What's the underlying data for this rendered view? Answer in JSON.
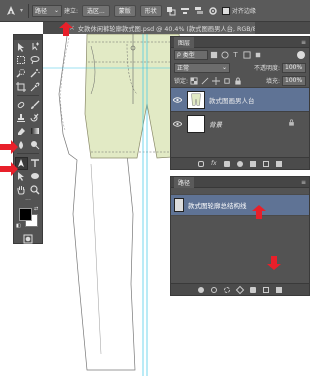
{
  "options_bar": {
    "tool_icon": "pen-icon",
    "mode_value": "路径",
    "make_label": "建立:",
    "selection_button": "选区...",
    "mask_button": "蒙版",
    "shape_button": "形状",
    "align_edges_label": "对齐边缘"
  },
  "document_tab": {
    "title": "女款休闲裤轮廓款式图.psd @ 40.4% (款式图画男人台, RGB/8) *"
  },
  "toolbox": {
    "active_tool": "pen-tool",
    "foreground_color": "#000000",
    "background_color": "#ffffff"
  },
  "layers_panel": {
    "title": "图层",
    "filter_kind": "类型",
    "blend_mode": "正常",
    "opacity_label": "不透明度:",
    "opacity_value": "100%",
    "lock_label": "锁定:",
    "fill_label": "填充:",
    "fill_value": "100%",
    "layers": [
      {
        "name": "款式图画男人台",
        "selected": true
      },
      {
        "name": "背景",
        "selected": false,
        "locked": true
      }
    ]
  },
  "paths_panel": {
    "title": "路径",
    "paths": [
      {
        "name": "款式图轮廓总结构线",
        "selected": true
      }
    ]
  },
  "colors": {
    "ui_dark": "#535353",
    "selection": "#5f7395",
    "arrow": "#e8202a",
    "pants_fill": "#e2eac5"
  }
}
